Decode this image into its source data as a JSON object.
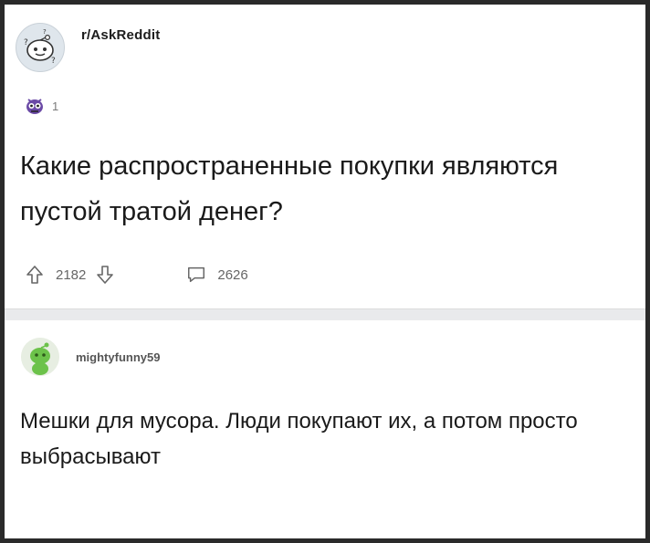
{
  "post": {
    "subreddit": "r/AskReddit",
    "award_count": "1",
    "title": "Какие распространенные покупки являются пустой тратой денег?",
    "vote_count": "2182",
    "comment_count": "2626"
  },
  "comment": {
    "username": "mightyfunny59",
    "text": "Мешки для мусора. Люди покупают их, а потом просто выбрасывают"
  },
  "icons": {
    "subreddit_avatar": "askreddit-snoo-icon",
    "award": "award-icon",
    "upvote": "upvote-arrow-icon",
    "downvote": "downvote-arrow-icon",
    "comment": "comment-bubble-icon",
    "user_avatar": "snoo-avatar-icon"
  },
  "colors": {
    "text": "#1a1a1a",
    "muted": "#666666",
    "separator": "#e9eaec",
    "avatar_green": "#6cc24a"
  }
}
